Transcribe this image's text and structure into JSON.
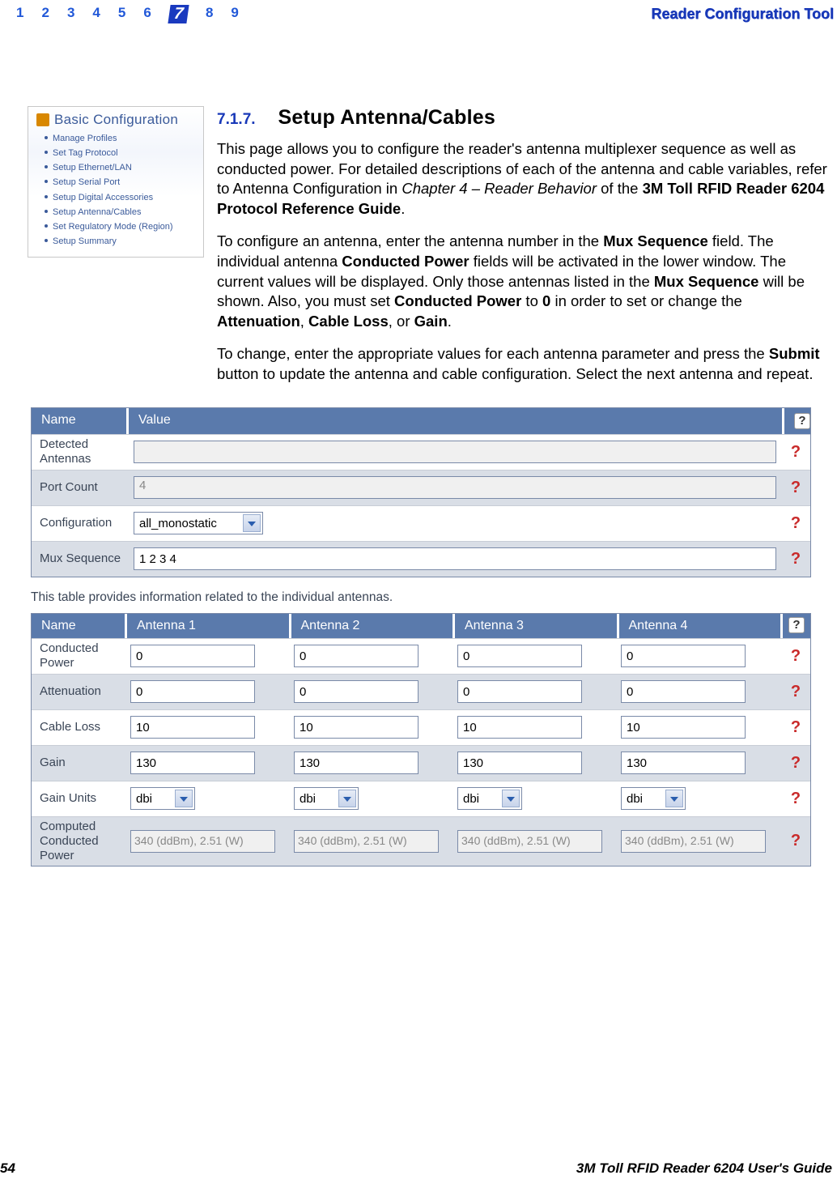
{
  "header": {
    "chapters": [
      "1",
      "2",
      "3",
      "4",
      "5",
      "6",
      "7",
      "8",
      "9"
    ],
    "active_index": 6,
    "title": "Reader Configuration Tool"
  },
  "section": {
    "number": "7.1.7.",
    "title": "Setup Antenna/Cables"
  },
  "sidebar_mock": {
    "title": "Basic Configuration",
    "items": [
      "Manage Profiles",
      "Set Tag Protocol",
      "Setup Ethernet/LAN",
      "Setup Serial Port",
      "Setup Digital Accessories",
      "Setup Antenna/Cables",
      "Set Regulatory Mode (Region)",
      "Setup Summary"
    ]
  },
  "paragraphs": {
    "p1_prefix": "This page allows you to configure the reader's antenna multiplexer sequence as well as conducted power. For detailed descriptions of each of the antenna and cable variables, refer to Antenna Configuration in ",
    "p1_italic": "Chapter 4 – Reader Behavior",
    "p1_mid": " of the ",
    "p1_bold": "3M Toll RFID Reader 6204 Protocol Reference Guide",
    "p1_end": ".",
    "p2_a": "To configure an antenna, enter the antenna number in the ",
    "p2_mux": "Mux Sequence",
    "p2_b": " field. The individual antenna ",
    "p2_cp": "Conducted Power",
    "p2_c": " fields will be activated in the lower window. The current values will be displayed. Only those antennas listed in the ",
    "p2_mux2": "Mux Sequence",
    "p2_d": " will be shown. Also, you must set ",
    "p2_cp2": "Conducted Power",
    "p2_e": " to ",
    "p2_zero": "0",
    "p2_f": " in order to set or change the ",
    "p2_att": "Attenuation",
    "p2_g": ", ",
    "p2_cl": "Cable Loss",
    "p2_h": ", or ",
    "p2_gain": "Gain",
    "p2_i": ".",
    "p3_a": "To change, enter the appropriate values for each antenna parameter and press the ",
    "p3_submit": "Submit",
    "p3_b": " button to update the antenna and cable configuration. Select the next antenna and repeat."
  },
  "top_table": {
    "head_name": "Name",
    "head_value": "Value",
    "help_symbol": "?",
    "rows": [
      {
        "label": "Detected Antennas",
        "value": "",
        "kind": "disabled"
      },
      {
        "label": "Port Count",
        "value": "4",
        "kind": "disabled_placeholder"
      },
      {
        "label": "Configuration",
        "value": "all_monostatic",
        "kind": "select_wide"
      },
      {
        "label": "Mux Sequence",
        "value": "1 2 3 4",
        "kind": "input"
      }
    ]
  },
  "note": "This table provides information related to the individual antennas.",
  "antenna_table": {
    "head_name": "Name",
    "cols": [
      "Antenna 1",
      "Antenna 2",
      "Antenna 3",
      "Antenna 4"
    ],
    "rows": [
      {
        "label": "Conducted Power",
        "values": [
          "0",
          "0",
          "0",
          "0"
        ],
        "kind": "input"
      },
      {
        "label": "Attenuation",
        "values": [
          "0",
          "0",
          "0",
          "0"
        ],
        "kind": "input"
      },
      {
        "label": "Cable Loss",
        "values": [
          "10",
          "10",
          "10",
          "10"
        ],
        "kind": "input"
      },
      {
        "label": "Gain",
        "values": [
          "130",
          "130",
          "130",
          "130"
        ],
        "kind": "input"
      },
      {
        "label": "Gain Units",
        "values": [
          "dbi",
          "dbi",
          "dbi",
          "dbi"
        ],
        "kind": "select"
      },
      {
        "label": "Computed Conducted Power",
        "values": [
          "340 (ddBm), 2.51 (W)",
          "340 (ddBm), 2.51 (W)",
          "340 (ddBm), 2.51 (W)",
          "340 (ddBm), 2.51 (W)"
        ],
        "kind": "readonly"
      }
    ]
  },
  "footer": {
    "page": "54",
    "title": "3M Toll RFID Reader 6204 User's Guide"
  }
}
